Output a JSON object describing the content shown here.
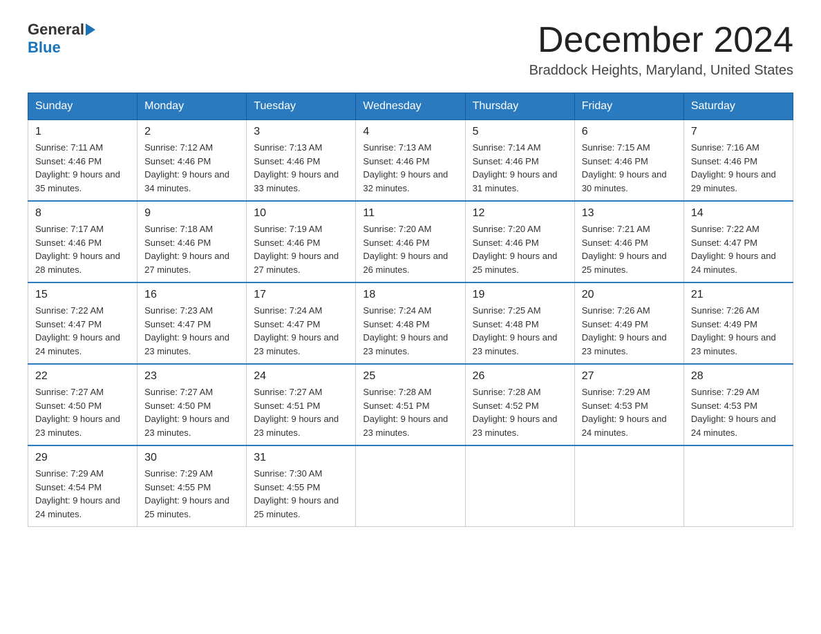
{
  "header": {
    "logo_general": "General",
    "logo_blue": "Blue",
    "month_title": "December 2024",
    "location": "Braddock Heights, Maryland, United States"
  },
  "weekdays": [
    "Sunday",
    "Monday",
    "Tuesday",
    "Wednesday",
    "Thursday",
    "Friday",
    "Saturday"
  ],
  "weeks": [
    [
      {
        "day": "1",
        "sunrise": "Sunrise: 7:11 AM",
        "sunset": "Sunset: 4:46 PM",
        "daylight": "Daylight: 9 hours and 35 minutes."
      },
      {
        "day": "2",
        "sunrise": "Sunrise: 7:12 AM",
        "sunset": "Sunset: 4:46 PM",
        "daylight": "Daylight: 9 hours and 34 minutes."
      },
      {
        "day": "3",
        "sunrise": "Sunrise: 7:13 AM",
        "sunset": "Sunset: 4:46 PM",
        "daylight": "Daylight: 9 hours and 33 minutes."
      },
      {
        "day": "4",
        "sunrise": "Sunrise: 7:13 AM",
        "sunset": "Sunset: 4:46 PM",
        "daylight": "Daylight: 9 hours and 32 minutes."
      },
      {
        "day": "5",
        "sunrise": "Sunrise: 7:14 AM",
        "sunset": "Sunset: 4:46 PM",
        "daylight": "Daylight: 9 hours and 31 minutes."
      },
      {
        "day": "6",
        "sunrise": "Sunrise: 7:15 AM",
        "sunset": "Sunset: 4:46 PM",
        "daylight": "Daylight: 9 hours and 30 minutes."
      },
      {
        "day": "7",
        "sunrise": "Sunrise: 7:16 AM",
        "sunset": "Sunset: 4:46 PM",
        "daylight": "Daylight: 9 hours and 29 minutes."
      }
    ],
    [
      {
        "day": "8",
        "sunrise": "Sunrise: 7:17 AM",
        "sunset": "Sunset: 4:46 PM",
        "daylight": "Daylight: 9 hours and 28 minutes."
      },
      {
        "day": "9",
        "sunrise": "Sunrise: 7:18 AM",
        "sunset": "Sunset: 4:46 PM",
        "daylight": "Daylight: 9 hours and 27 minutes."
      },
      {
        "day": "10",
        "sunrise": "Sunrise: 7:19 AM",
        "sunset": "Sunset: 4:46 PM",
        "daylight": "Daylight: 9 hours and 27 minutes."
      },
      {
        "day": "11",
        "sunrise": "Sunrise: 7:20 AM",
        "sunset": "Sunset: 4:46 PM",
        "daylight": "Daylight: 9 hours and 26 minutes."
      },
      {
        "day": "12",
        "sunrise": "Sunrise: 7:20 AM",
        "sunset": "Sunset: 4:46 PM",
        "daylight": "Daylight: 9 hours and 25 minutes."
      },
      {
        "day": "13",
        "sunrise": "Sunrise: 7:21 AM",
        "sunset": "Sunset: 4:46 PM",
        "daylight": "Daylight: 9 hours and 25 minutes."
      },
      {
        "day": "14",
        "sunrise": "Sunrise: 7:22 AM",
        "sunset": "Sunset: 4:47 PM",
        "daylight": "Daylight: 9 hours and 24 minutes."
      }
    ],
    [
      {
        "day": "15",
        "sunrise": "Sunrise: 7:22 AM",
        "sunset": "Sunset: 4:47 PM",
        "daylight": "Daylight: 9 hours and 24 minutes."
      },
      {
        "day": "16",
        "sunrise": "Sunrise: 7:23 AM",
        "sunset": "Sunset: 4:47 PM",
        "daylight": "Daylight: 9 hours and 23 minutes."
      },
      {
        "day": "17",
        "sunrise": "Sunrise: 7:24 AM",
        "sunset": "Sunset: 4:47 PM",
        "daylight": "Daylight: 9 hours and 23 minutes."
      },
      {
        "day": "18",
        "sunrise": "Sunrise: 7:24 AM",
        "sunset": "Sunset: 4:48 PM",
        "daylight": "Daylight: 9 hours and 23 minutes."
      },
      {
        "day": "19",
        "sunrise": "Sunrise: 7:25 AM",
        "sunset": "Sunset: 4:48 PM",
        "daylight": "Daylight: 9 hours and 23 minutes."
      },
      {
        "day": "20",
        "sunrise": "Sunrise: 7:26 AM",
        "sunset": "Sunset: 4:49 PM",
        "daylight": "Daylight: 9 hours and 23 minutes."
      },
      {
        "day": "21",
        "sunrise": "Sunrise: 7:26 AM",
        "sunset": "Sunset: 4:49 PM",
        "daylight": "Daylight: 9 hours and 23 minutes."
      }
    ],
    [
      {
        "day": "22",
        "sunrise": "Sunrise: 7:27 AM",
        "sunset": "Sunset: 4:50 PM",
        "daylight": "Daylight: 9 hours and 23 minutes."
      },
      {
        "day": "23",
        "sunrise": "Sunrise: 7:27 AM",
        "sunset": "Sunset: 4:50 PM",
        "daylight": "Daylight: 9 hours and 23 minutes."
      },
      {
        "day": "24",
        "sunrise": "Sunrise: 7:27 AM",
        "sunset": "Sunset: 4:51 PM",
        "daylight": "Daylight: 9 hours and 23 minutes."
      },
      {
        "day": "25",
        "sunrise": "Sunrise: 7:28 AM",
        "sunset": "Sunset: 4:51 PM",
        "daylight": "Daylight: 9 hours and 23 minutes."
      },
      {
        "day": "26",
        "sunrise": "Sunrise: 7:28 AM",
        "sunset": "Sunset: 4:52 PM",
        "daylight": "Daylight: 9 hours and 23 minutes."
      },
      {
        "day": "27",
        "sunrise": "Sunrise: 7:29 AM",
        "sunset": "Sunset: 4:53 PM",
        "daylight": "Daylight: 9 hours and 24 minutes."
      },
      {
        "day": "28",
        "sunrise": "Sunrise: 7:29 AM",
        "sunset": "Sunset: 4:53 PM",
        "daylight": "Daylight: 9 hours and 24 minutes."
      }
    ],
    [
      {
        "day": "29",
        "sunrise": "Sunrise: 7:29 AM",
        "sunset": "Sunset: 4:54 PM",
        "daylight": "Daylight: 9 hours and 24 minutes."
      },
      {
        "day": "30",
        "sunrise": "Sunrise: 7:29 AM",
        "sunset": "Sunset: 4:55 PM",
        "daylight": "Daylight: 9 hours and 25 minutes."
      },
      {
        "day": "31",
        "sunrise": "Sunrise: 7:30 AM",
        "sunset": "Sunset: 4:55 PM",
        "daylight": "Daylight: 9 hours and 25 minutes."
      },
      null,
      null,
      null,
      null
    ]
  ]
}
